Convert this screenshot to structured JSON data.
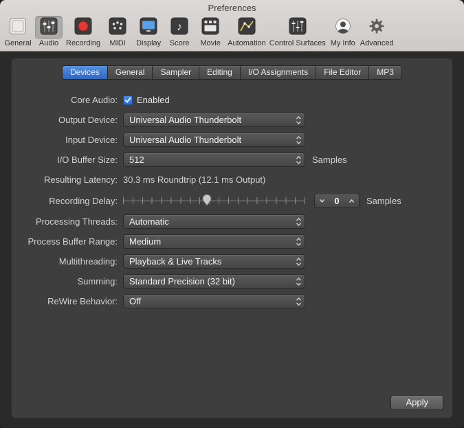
{
  "window": {
    "title": "Preferences"
  },
  "toolbar": {
    "items": [
      {
        "label": "General",
        "selected": false
      },
      {
        "label": "Audio",
        "selected": true
      },
      {
        "label": "Recording",
        "selected": false
      },
      {
        "label": "MIDI",
        "selected": false
      },
      {
        "label": "Display",
        "selected": false
      },
      {
        "label": "Score",
        "selected": false
      },
      {
        "label": "Movie",
        "selected": false
      },
      {
        "label": "Automation",
        "selected": false
      },
      {
        "label": "Control Surfaces",
        "selected": false
      },
      {
        "label": "My Info",
        "selected": false
      },
      {
        "label": "Advanced",
        "selected": false
      }
    ]
  },
  "tabs": {
    "items": [
      {
        "label": "Devices",
        "selected": true
      },
      {
        "label": "General",
        "selected": false
      },
      {
        "label": "Sampler",
        "selected": false
      },
      {
        "label": "Editing",
        "selected": false
      },
      {
        "label": "I/O Assignments",
        "selected": false
      },
      {
        "label": "File Editor",
        "selected": false
      },
      {
        "label": "MP3",
        "selected": false
      }
    ]
  },
  "form": {
    "core_audio": {
      "label": "Core Audio:",
      "checkbox_label": "Enabled",
      "checked": true
    },
    "output_device": {
      "label": "Output Device:",
      "value": "Universal Audio Thunderbolt"
    },
    "input_device": {
      "label": "Input Device:",
      "value": "Universal Audio Thunderbolt"
    },
    "io_buffer_size": {
      "label": "I/O Buffer Size:",
      "value": "512",
      "unit": "Samples"
    },
    "resulting_latency": {
      "label": "Resulting Latency:",
      "value": "30.3 ms Roundtrip (12.1 ms Output)"
    },
    "recording_delay": {
      "label": "Recording Delay:",
      "value": "0",
      "unit": "Samples",
      "slider_position_percent": 46
    },
    "processing_threads": {
      "label": "Processing Threads:",
      "value": "Automatic"
    },
    "process_buffer_range": {
      "label": "Process Buffer Range:",
      "value": "Medium"
    },
    "multithreading": {
      "label": "Multithreading:",
      "value": "Playback & Live Tracks"
    },
    "summing": {
      "label": "Summing:",
      "value": "Standard Precision (32 bit)"
    },
    "rewire_behavior": {
      "label": "ReWire Behavior:",
      "value": "Off"
    }
  },
  "buttons": {
    "apply": "Apply"
  },
  "colors": {
    "accent_blue": "#3a77d8",
    "record_red": "#e23b34",
    "toolbar_bg": "#d5d3d1",
    "panel_bg": "#3e3e3e"
  }
}
